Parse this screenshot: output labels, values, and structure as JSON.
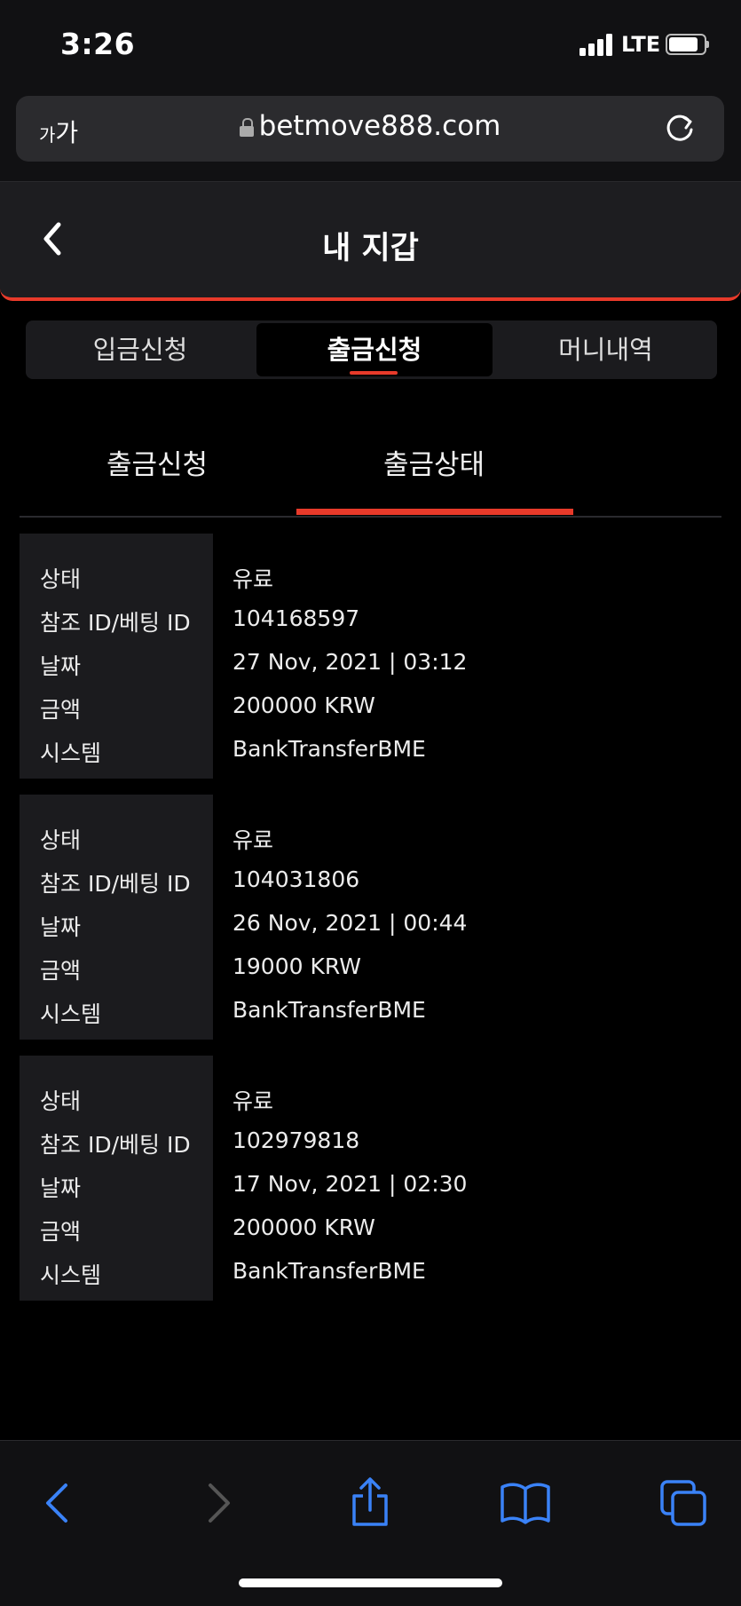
{
  "status_bar": {
    "time": "3:26",
    "network": "LTE"
  },
  "browser": {
    "text_size_small": "가",
    "text_size_large": "가",
    "url": "betmove888.com"
  },
  "header": {
    "title": "내 지갑"
  },
  "tabs": [
    {
      "label": "입금신청",
      "active": false
    },
    {
      "label": "출금신청",
      "active": true
    },
    {
      "label": "머니내역",
      "active": false
    }
  ],
  "subtabs": [
    {
      "label": "출금신청",
      "active": false
    },
    {
      "label": "출금상태",
      "active": true
    }
  ],
  "field_labels": {
    "status": "상태",
    "ref_id": "참조 ID/베팅 ID",
    "date": "날짜",
    "amount": "금액",
    "system": "시스템"
  },
  "records": [
    {
      "status": "유료",
      "ref_id": "104168597",
      "date": "27 Nov, 2021 | 03:12",
      "amount": "200000 KRW",
      "system": "BankTransferBME"
    },
    {
      "status": "유료",
      "ref_id": "104031806",
      "date": "26 Nov, 2021 | 00:44",
      "amount": "19000 KRW",
      "system": "BankTransferBME"
    },
    {
      "status": "유료",
      "ref_id": "102979818",
      "date": "17 Nov, 2021 | 02:30",
      "amount": "200000 KRW",
      "system": "BankTransferBME"
    }
  ],
  "colors": {
    "accent": "#e83a2a",
    "ios_blue": "#3a82f7",
    "panel": "#1b1b1e"
  },
  "icons": [
    "signal-icon",
    "battery-icon",
    "lock-icon",
    "reload-icon",
    "back-icon",
    "nav-back-icon",
    "nav-forward-icon",
    "share-icon",
    "bookmarks-icon",
    "tabs-icon"
  ]
}
